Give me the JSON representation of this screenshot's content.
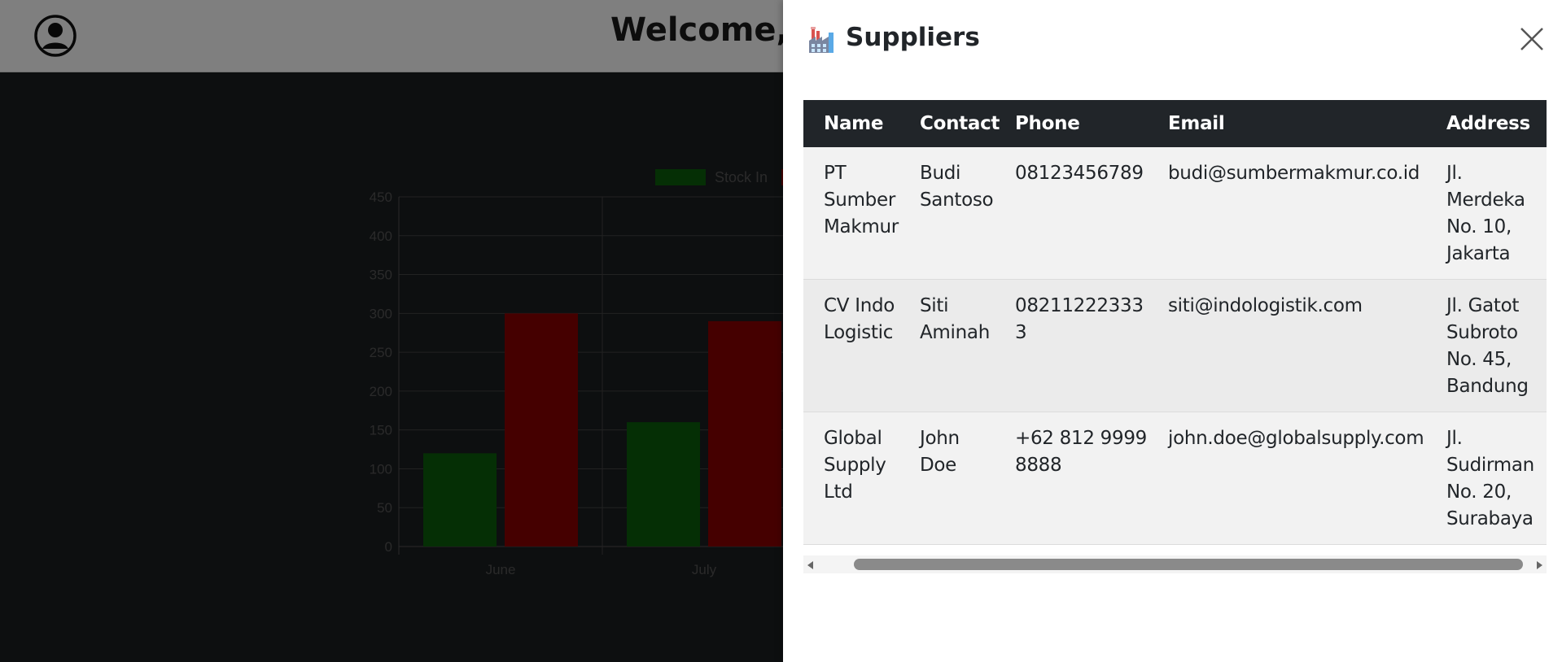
{
  "header": {
    "welcome_text": "Welcome,",
    "avatar_icon": "user-circle-icon"
  },
  "chart_data": {
    "type": "bar",
    "categories": [
      "June",
      "July"
    ],
    "series": [
      {
        "name": "Stock In",
        "values": [
          120,
          160
        ],
        "color": "#0a5e0a"
      },
      {
        "name": "",
        "values": [
          300,
          290
        ],
        "color": "#8b0000"
      }
    ],
    "ylim": [
      0,
      450
    ],
    "yticks": [
      0,
      50,
      100,
      150,
      200,
      250,
      300,
      350,
      400,
      450
    ],
    "xlabel": "",
    "ylabel": "",
    "grid": true,
    "legend": "top"
  },
  "panel": {
    "title": "Suppliers",
    "icon": "factory-icon",
    "close_icon": "close-icon",
    "table": {
      "columns": [
        "Name",
        "Contact",
        "Phone",
        "Email",
        "Address"
      ],
      "rows": [
        [
          "PT Sumber Makmur",
          "Budi Santoso",
          "08123456789",
          "budi@sumbermakmur.co.id",
          "Jl. Merdeka No. 10, Jakarta"
        ],
        [
          "CV Indo Logistic",
          "Siti Aminah",
          "082112223333",
          "siti@indologistik.com",
          "Jl. Gatot Subroto No. 45, Bandung"
        ],
        [
          "Global Supply Ltd",
          "John Doe",
          "+62 812 9999 8888",
          "john.doe@globalsupply.com",
          "Jl. Sudirman No. 20, Surabaya"
        ]
      ]
    }
  }
}
